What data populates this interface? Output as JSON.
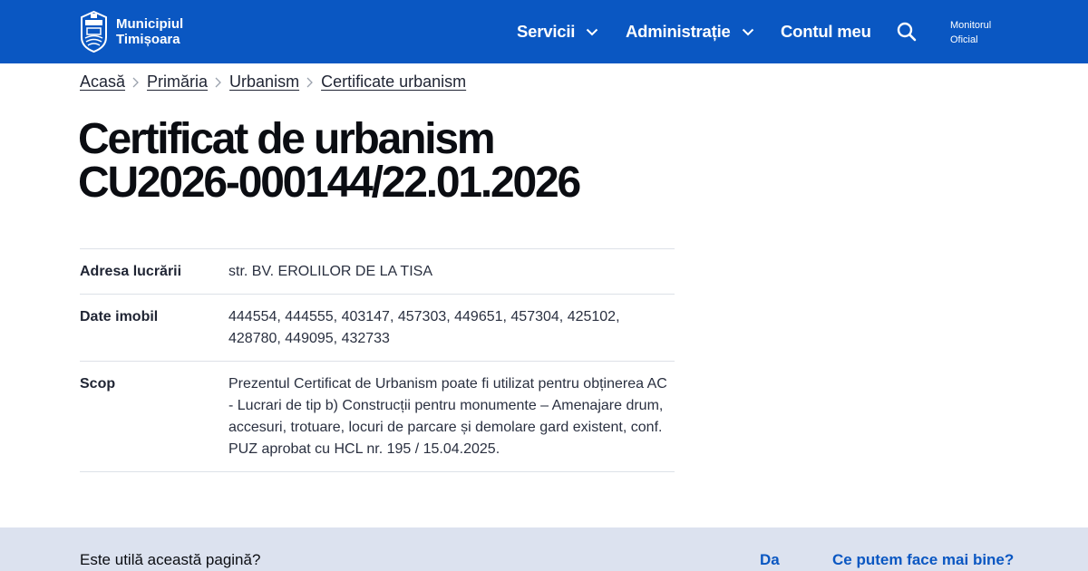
{
  "header": {
    "logo_line1": "Municipiul",
    "logo_line2": "Timișoara",
    "nav": [
      "Servicii",
      "Administrație",
      "Contul meu"
    ],
    "search_icon": "search-icon",
    "monitor_line1": "Monitorul",
    "monitor_line2": "Oficial",
    "bg_color": "#0a57c2"
  },
  "breadcrumb": [
    "Acasă",
    "Primăria",
    "Urbanism",
    "Certificate urbanism"
  ],
  "page": {
    "title_line1": "Certificat de urbanism",
    "title_line2": "CU2026-000144/22.01.2026"
  },
  "details": [
    {
      "label": "Adresa lucrării",
      "value": "str. BV. EROLILOR DE LA TISA"
    },
    {
      "label": "Date imobil",
      "value": "444554, 444555, 403147, 457303, 449651, 457304, 425102, 428780, 449095, 432733"
    },
    {
      "label": "Scop",
      "value": "Prezentul Certificat de Urbanism poate fi utilizat pentru obținerea AC - Lucrari de tip b) Construcții pentru monumente – Amenajare drum, accesuri, trotuare, locuri de parcare și demolare gard existent, conf. PUZ aprobat cu HCL nr. 195 / 15.04.2025."
    }
  ],
  "feedback": {
    "question": "Este utilă această pagină?",
    "yes": "Da",
    "improve": "Ce putem face mai bine?",
    "bg_color": "#dce2ef"
  }
}
